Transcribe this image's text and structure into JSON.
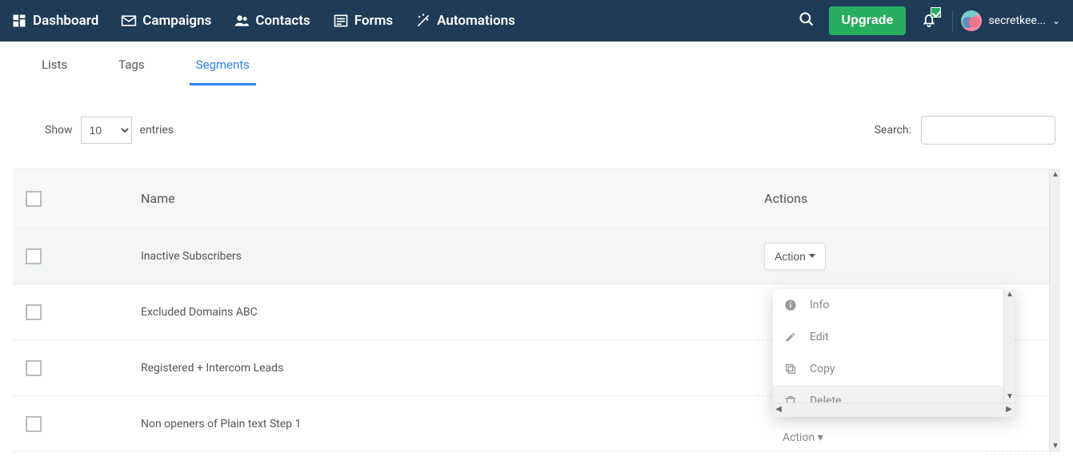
{
  "nav": {
    "items": [
      {
        "label": "Dashboard"
      },
      {
        "label": "Campaigns"
      },
      {
        "label": "Contacts"
      },
      {
        "label": "Forms"
      },
      {
        "label": "Automations"
      }
    ],
    "upgrade": "Upgrade",
    "user": "secretkee..."
  },
  "tabs": {
    "lists": "Lists",
    "tags": "Tags",
    "segments": "Segments"
  },
  "controls": {
    "show": "Show",
    "page_size": "10",
    "entries": "entries",
    "search_label": "Search:"
  },
  "table": {
    "head_name": "Name",
    "head_actions": "Actions",
    "action_btn": "Action",
    "rows": [
      {
        "name": "Inactive Subscribers"
      },
      {
        "name": "Excluded Domains ABC"
      },
      {
        "name": "Registered + Intercom Leads"
      },
      {
        "name": "Non openers of Plain text Step 1"
      }
    ]
  },
  "dropdown": {
    "info": "Info",
    "edit": "Edit",
    "copy": "Copy",
    "delete": "Delete"
  },
  "ghost_action": "Action ▾"
}
